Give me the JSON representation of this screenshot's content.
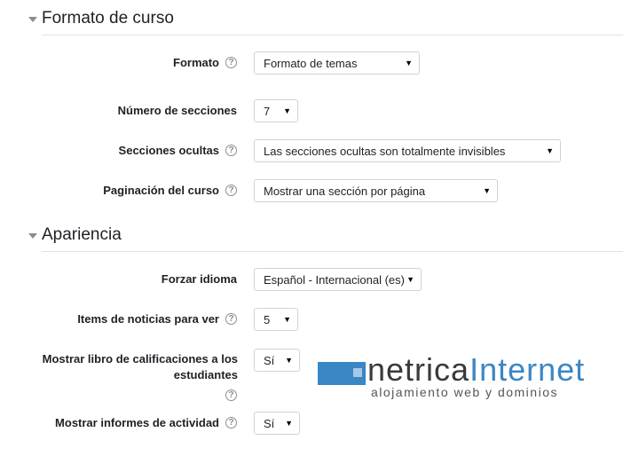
{
  "sections": {
    "formato": {
      "title": "Formato de curso",
      "fields": {
        "formato": {
          "label": "Formato",
          "value": "Formato de temas"
        },
        "numero_secciones": {
          "label": "Número de secciones",
          "value": "7"
        },
        "secciones_ocultas": {
          "label": "Secciones ocultas",
          "value": "Las secciones ocultas son totalmente invisibles"
        },
        "paginacion": {
          "label": "Paginación del curso",
          "value": "Mostrar una sección por página"
        }
      }
    },
    "apariencia": {
      "title": "Apariencia",
      "fields": {
        "forzar_idioma": {
          "label": "Forzar idioma",
          "value": "Español - Internacional (es)"
        },
        "items_noticias": {
          "label": "Items de noticias para ver",
          "value": "5"
        },
        "libro_calificaciones": {
          "label_line1": "Mostrar libro de calificaciones a los",
          "label_line2": "estudiantes",
          "value": "Sí"
        },
        "informes_actividad": {
          "label": "Mostrar informes de actividad",
          "value": "Sí"
        }
      }
    }
  },
  "watermark": {
    "brand_part1": "netrica",
    "brand_part2": "Internet",
    "tagline": "alojamiento web y dominios"
  },
  "icons": {
    "help": "help-circle-icon",
    "collapse": "caret-down-icon",
    "dropdown": "dropdown-arrow-icon"
  },
  "colors": {
    "accent": "#3b86c4",
    "text": "#1d2125",
    "border": "#ced4da",
    "muted": "#8a8d90"
  }
}
